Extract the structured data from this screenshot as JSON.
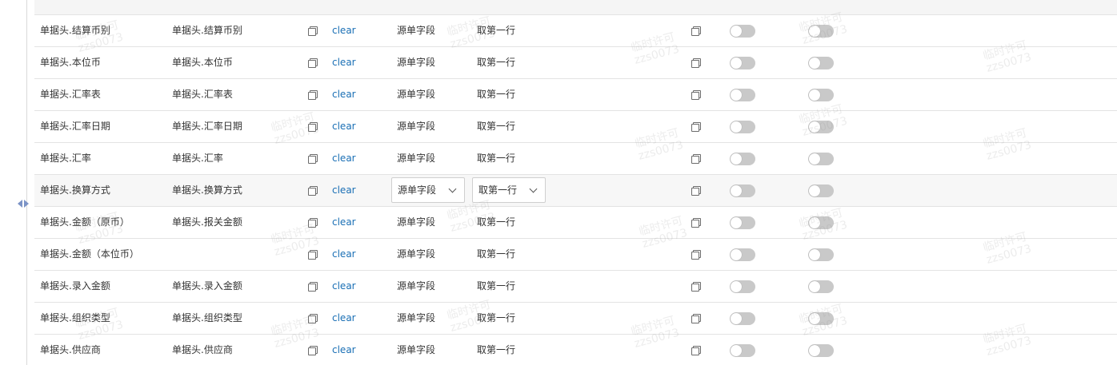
{
  "clear_label": "clear",
  "rows": [
    {
      "field": "单据头.结算币别",
      "target": "单据头.结算币别",
      "source": "源单字段",
      "rule": "取第一行",
      "editing": false
    },
    {
      "field": "单据头.本位币",
      "target": "单据头.本位币",
      "source": "源单字段",
      "rule": "取第一行",
      "editing": false
    },
    {
      "field": "单据头.汇率表",
      "target": "单据头.汇率表",
      "source": "源单字段",
      "rule": "取第一行",
      "editing": false
    },
    {
      "field": "单据头.汇率日期",
      "target": "单据头.汇率日期",
      "source": "源单字段",
      "rule": "取第一行",
      "editing": false
    },
    {
      "field": "单据头.汇率",
      "target": "单据头.汇率",
      "source": "源单字段",
      "rule": "取第一行",
      "editing": false
    },
    {
      "field": "单据头.换算方式",
      "target": "单据头.换算方式",
      "source": "源单字段",
      "rule": "取第一行",
      "editing": true
    },
    {
      "field": "单据头.金额（原币）",
      "target": "单据头.报关金额",
      "source": "源单字段",
      "rule": "取第一行",
      "editing": false
    },
    {
      "field": "单据头.金额（本位币）",
      "target": "",
      "source": "源单字段",
      "rule": "取第一行",
      "editing": false
    },
    {
      "field": "单据头.录入金额",
      "target": "单据头.录入金额",
      "source": "源单字段",
      "rule": "取第一行",
      "editing": false
    },
    {
      "field": "单据头.组织类型",
      "target": "单据头.组织类型",
      "source": "源单字段",
      "rule": "取第一行",
      "editing": false
    },
    {
      "field": "单据头.供应商",
      "target": "单据头.供应商",
      "source": "源单字段",
      "rule": "取第一行",
      "editing": false
    }
  ],
  "toggles_on": false,
  "colors": {
    "link": "#1a6fb5",
    "toggle_off": "#c9c9c9",
    "splitter": "#7b93c6"
  },
  "icons": {
    "copy": "copy-icon",
    "chevron": "chevron-down-icon",
    "collapse": "collapse-left-icon",
    "expand": "expand-right-icon"
  },
  "watermark": {
    "line1": "临时许可",
    "line2": "zzs0073"
  }
}
